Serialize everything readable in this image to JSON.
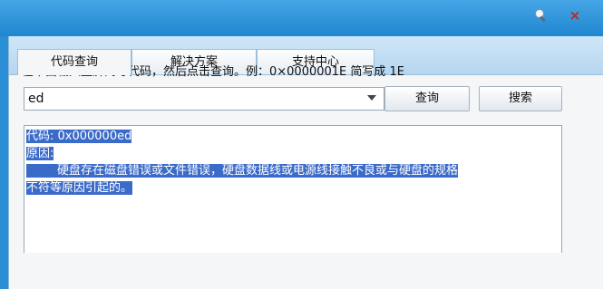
{
  "window": {
    "title_buttons": [
      {
        "icon": "wrench-settings-icon"
      },
      {
        "icon": "close-icon",
        "label": "×"
      }
    ]
  },
  "tabs": [
    {
      "label": "代码查询",
      "active": true
    },
    {
      "label": "解决方案",
      "active": false
    },
    {
      "label": "支持中心",
      "active": false
    }
  ],
  "instruction": "在下面输入蓝屏简写代码，然后点击查询。例：0×0000001E 简写成 1E",
  "query": {
    "value": "ed",
    "query_button": "查询",
    "search_button": "搜索"
  },
  "result": {
    "code_line": "代码: 0x000000ed",
    "reason_label": "原因:",
    "reason_line1": "硬盘存在磁盘错误或文件错误，硬盘数据线或电源线接触不良或与硬盘的规格",
    "reason_line2": "不符等原因引起的。"
  },
  "colors": {
    "titlebar": "#2a8fd4",
    "selection": "#3b6bc9",
    "close": "#c8241a"
  }
}
